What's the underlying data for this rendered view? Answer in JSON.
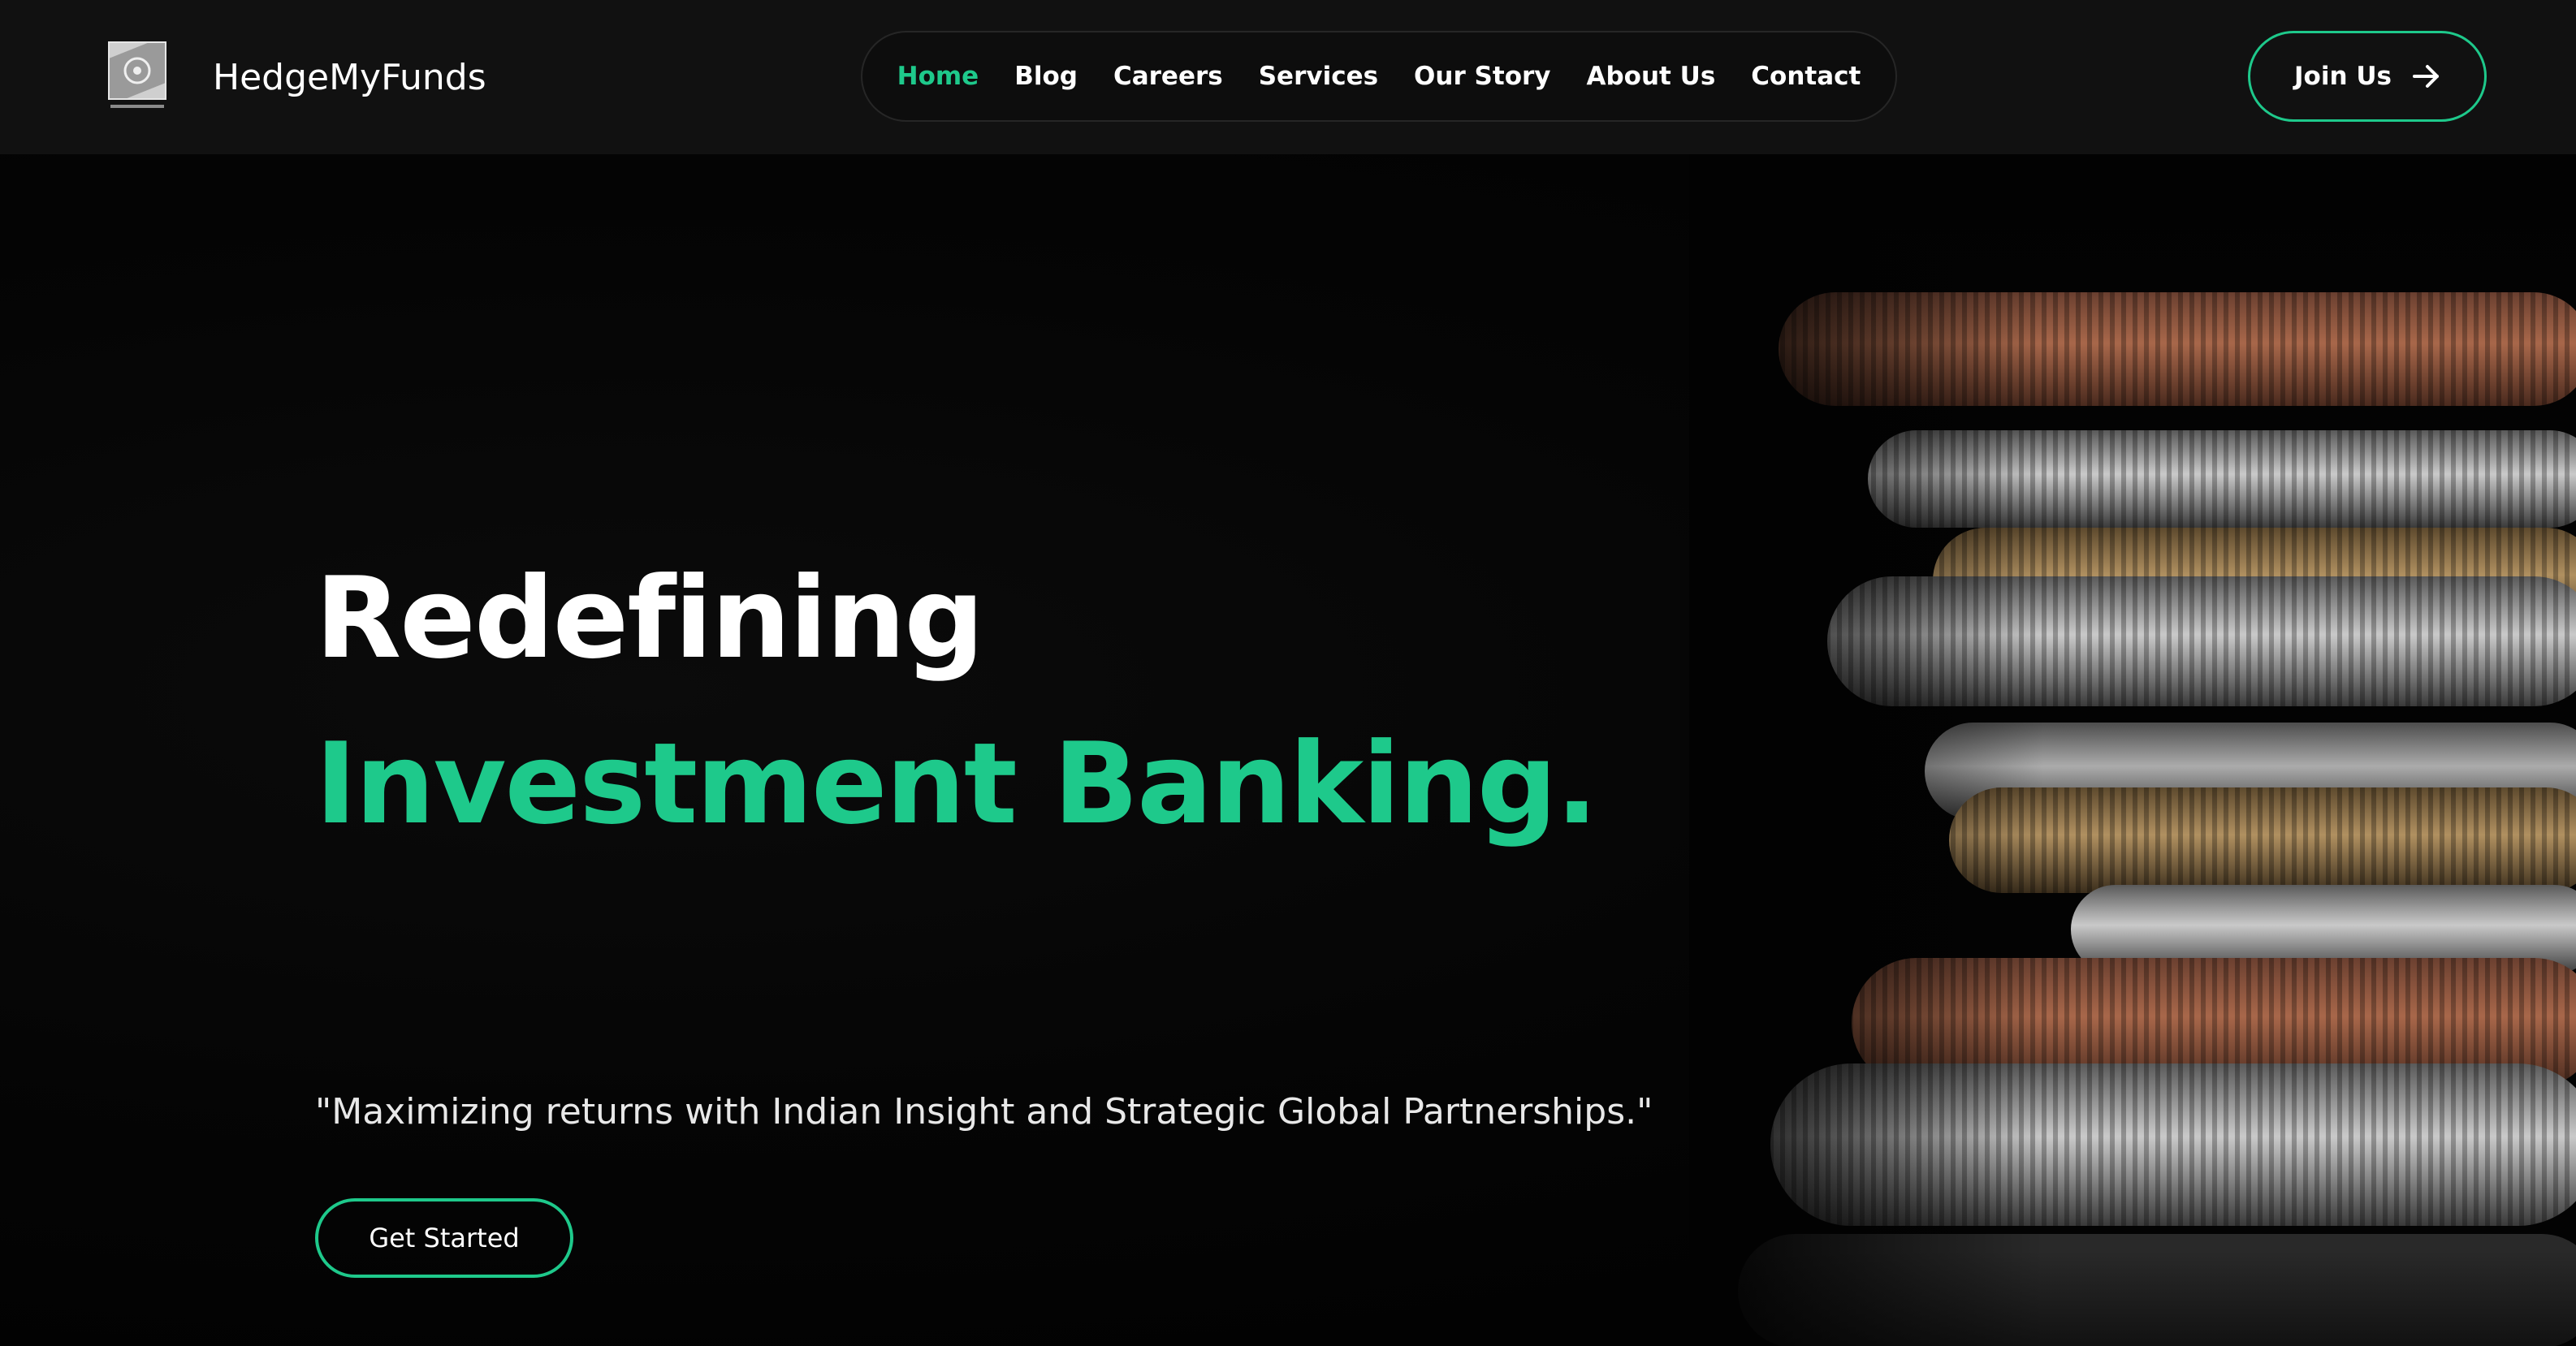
{
  "header": {
    "brand_name": "HedgeMyFunds",
    "logo_caption": "HEDGE MY FUNDS",
    "nav_items": [
      {
        "label": "Home",
        "active": true
      },
      {
        "label": "Blog",
        "active": false
      },
      {
        "label": "Careers",
        "active": false
      },
      {
        "label": "Services",
        "active": false
      },
      {
        "label": "Our Story",
        "active": false
      },
      {
        "label": "About Us",
        "active": false
      },
      {
        "label": "Contact",
        "active": false
      }
    ],
    "join_label": "Join Us",
    "join_icon": "arrow-right-icon"
  },
  "hero": {
    "title_plain": "Redefining ",
    "title_accent": "Investment Banking.",
    "subtitle": "\"Maximizing returns with Indian Insight and Strategic Global Partnerships.\"",
    "cta_label": "Get Started",
    "image": "stacked-coins-image"
  },
  "colors": {
    "accent": "#1ec98b",
    "navbar_bg": "#111111",
    "hero_bg": "#020202",
    "text": "#ffffff"
  }
}
